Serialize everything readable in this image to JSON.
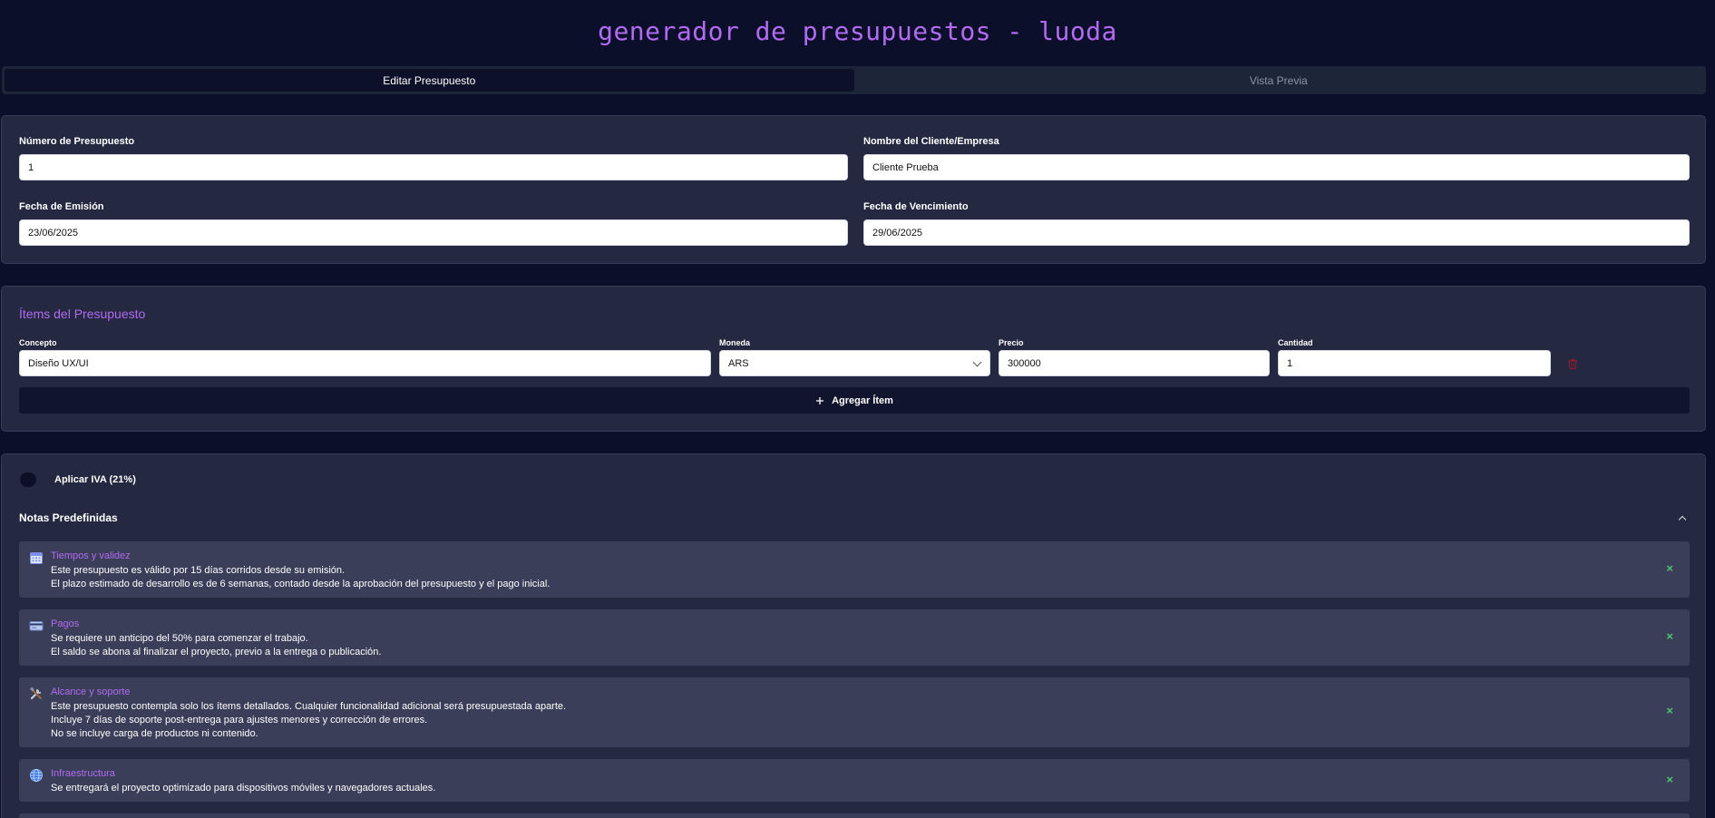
{
  "app_title": "generador de presupuestos - luoda",
  "tabs": [
    {
      "label": "Editar Presupuesto",
      "active": true
    },
    {
      "label": "Vista Previa",
      "active": false
    }
  ],
  "header_form": {
    "number_label": "Número de Presupuesto",
    "number_value": "1",
    "client_label": "Nombre del Cliente/Empresa",
    "client_value": "Cliente Prueba",
    "issue_label": "Fecha de Emisión",
    "issue_value": "23/06/2025",
    "due_label": "Fecha de Vencimiento",
    "due_value": "29/06/2025"
  },
  "items": {
    "title": "Ítems del Presupuesto",
    "headers": {
      "concept": "Concepto",
      "currency": "Moneda",
      "price": "Precio",
      "quantity": "Cantidad"
    },
    "rows": [
      {
        "concept": "Diseño UX/UI",
        "currency": "ARS",
        "price": "300000",
        "quantity": "1"
      }
    ],
    "add_label": "Agregar Ítem"
  },
  "iva": {
    "label": "Aplicar IVA (21%)",
    "enabled": false
  },
  "notes": {
    "title": "Notas Predefinidas",
    "list": [
      {
        "icon": "calendar-icon",
        "title": "Tiempos y validez",
        "lines": [
          "Este presupuesto es válido por 15 días corridos desde su emisión.",
          "El plazo estimado de desarrollo es de 6 semanas, contado desde la aprobación del presupuesto y el pago inicial."
        ]
      },
      {
        "icon": "credit-card-icon",
        "title": "Pagos",
        "lines": [
          "Se requiere un anticipo del 50% para comenzar el trabajo.",
          "El saldo se abona al finalizar el proyecto, previo a la entrega o publicación."
        ]
      },
      {
        "icon": "tools-icon",
        "title": "Alcance y soporte",
        "lines": [
          "Este presupuesto contempla solo los ítems detallados. Cualquier funcionalidad adicional será presupuestada aparte.",
          "Incluye 7 días de soporte post-entrega para ajustes menores y corrección de errores.",
          "No se incluye carga de productos ni contenido."
        ]
      },
      {
        "icon": "globe-icon",
        "title": "Infraestructura",
        "lines": [
          "Se entregará el proyecto optimizado para dispositivos móviles y navegadores actuales."
        ]
      }
    ]
  },
  "colors": {
    "accent": "#b26bf2",
    "background": "#0b0f2a",
    "card": "#242840",
    "note": "#3a3e58",
    "close": "#4ec46f",
    "trash": "#8a1f2c"
  }
}
